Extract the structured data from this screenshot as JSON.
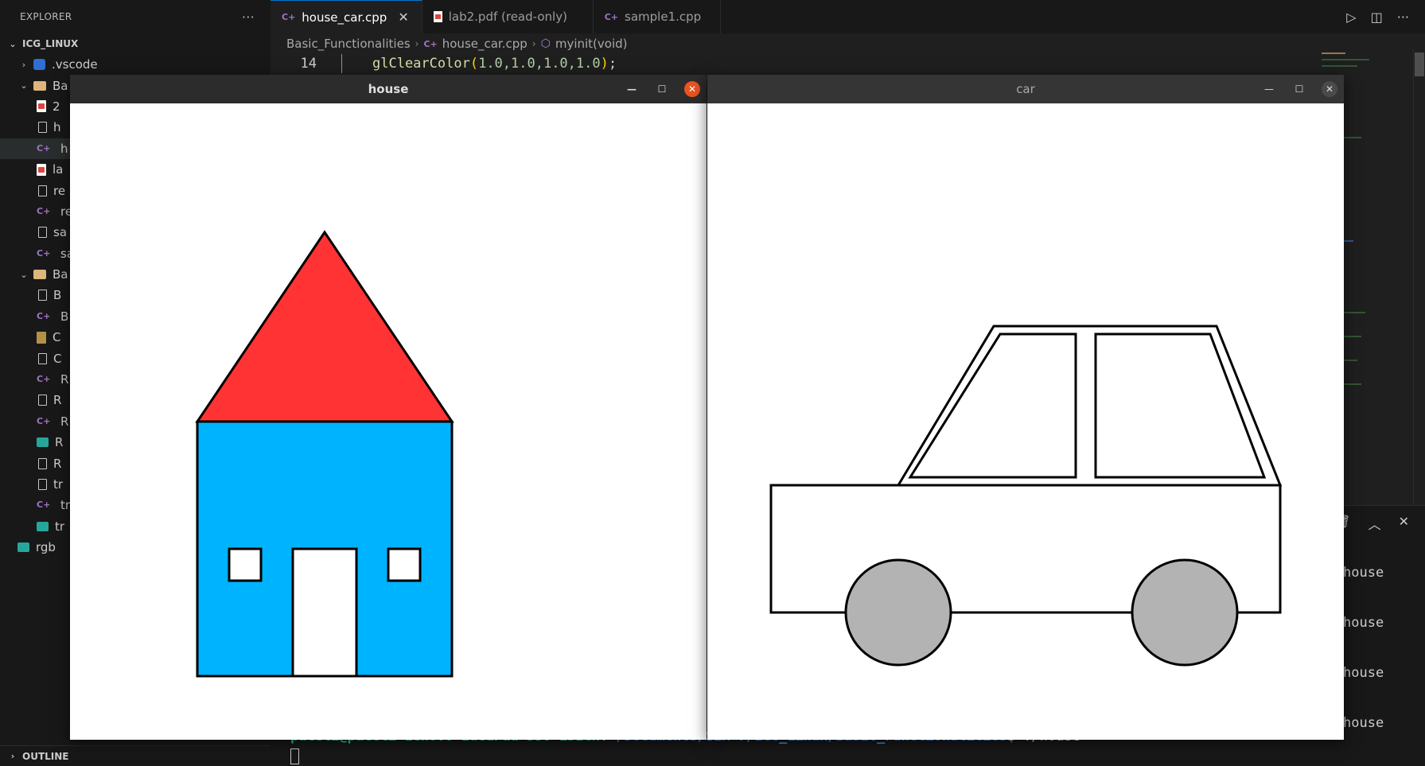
{
  "sidebar": {
    "header": "EXPLORER",
    "more": "···",
    "root": "ICG_LINUX",
    "items": [
      {
        "label": ".vscode",
        "icon": "vscode-folder-icon",
        "chev": "›"
      },
      {
        "label": "Ba",
        "icon": "folder-icon",
        "chev": "⌄"
      },
      {
        "label": "2",
        "icon": "pdf-file-icon"
      },
      {
        "label": "h",
        "icon": "file-icon"
      },
      {
        "label": "h",
        "icon": "cpp-file-icon"
      },
      {
        "label": "la",
        "icon": "pdf-file-icon"
      },
      {
        "label": "re",
        "icon": "file-icon"
      },
      {
        "label": "re",
        "icon": "cpp-file-icon"
      },
      {
        "label": "sa",
        "icon": "file-icon"
      },
      {
        "label": "sa",
        "icon": "cpp-file-icon"
      },
      {
        "label": "Ba",
        "icon": "folder-icon",
        "chev": "⌄"
      },
      {
        "label": "B",
        "icon": "file-icon"
      },
      {
        "label": "B",
        "icon": "cpp-file-icon"
      },
      {
        "label": "C",
        "icon": "zip-file-icon"
      },
      {
        "label": "C",
        "icon": "file-icon"
      },
      {
        "label": "R",
        "icon": "cpp-file-icon"
      },
      {
        "label": "R",
        "icon": "file-icon"
      },
      {
        "label": "R",
        "icon": "cpp-file-icon"
      },
      {
        "label": "R",
        "icon": "image-file-icon"
      },
      {
        "label": "R",
        "icon": "file-icon"
      },
      {
        "label": "tr",
        "icon": "file-icon"
      },
      {
        "label": "tr",
        "icon": "cpp-file-icon"
      },
      {
        "label": "tr",
        "icon": "image-file-icon"
      },
      {
        "label": "rgb",
        "icon": "image-file-icon"
      }
    ],
    "outline": "OUTLINE"
  },
  "tabs": [
    {
      "label": "house_car.cpp",
      "type": "cpp",
      "active": true,
      "close": "✕"
    },
    {
      "label": "lab2.pdf (read-only)",
      "type": "pdf",
      "active": false
    },
    {
      "label": "sample1.cpp",
      "type": "cpp",
      "active": false
    }
  ],
  "breadcrumb": {
    "folder": "Basic_Functionalities",
    "file": "house_car.cpp",
    "symbol": "myinit(void)"
  },
  "code": {
    "line_number": "14",
    "fn": "glClearColor",
    "args": "1.0,1.0,1.0,1.0",
    "end": ";"
  },
  "terminal": {
    "outputs": [
      "house",
      "house",
      "house",
      "house"
    ],
    "prompt_user": "pateli@pateli-Lenovo-IdeaPad-330-15ICH",
    "prompt_path": "~/Documents/SEM 7/ICG_Linux/Basic_Functionalities",
    "prompt_cmd": "$ ./house"
  },
  "windows": {
    "house": {
      "title": "house"
    },
    "car": {
      "title": "car"
    }
  },
  "colors": {
    "roof": "#ff3333",
    "wall": "#00b3ff",
    "wheel": "#b3b3b3",
    "close_active": "#e95420"
  }
}
